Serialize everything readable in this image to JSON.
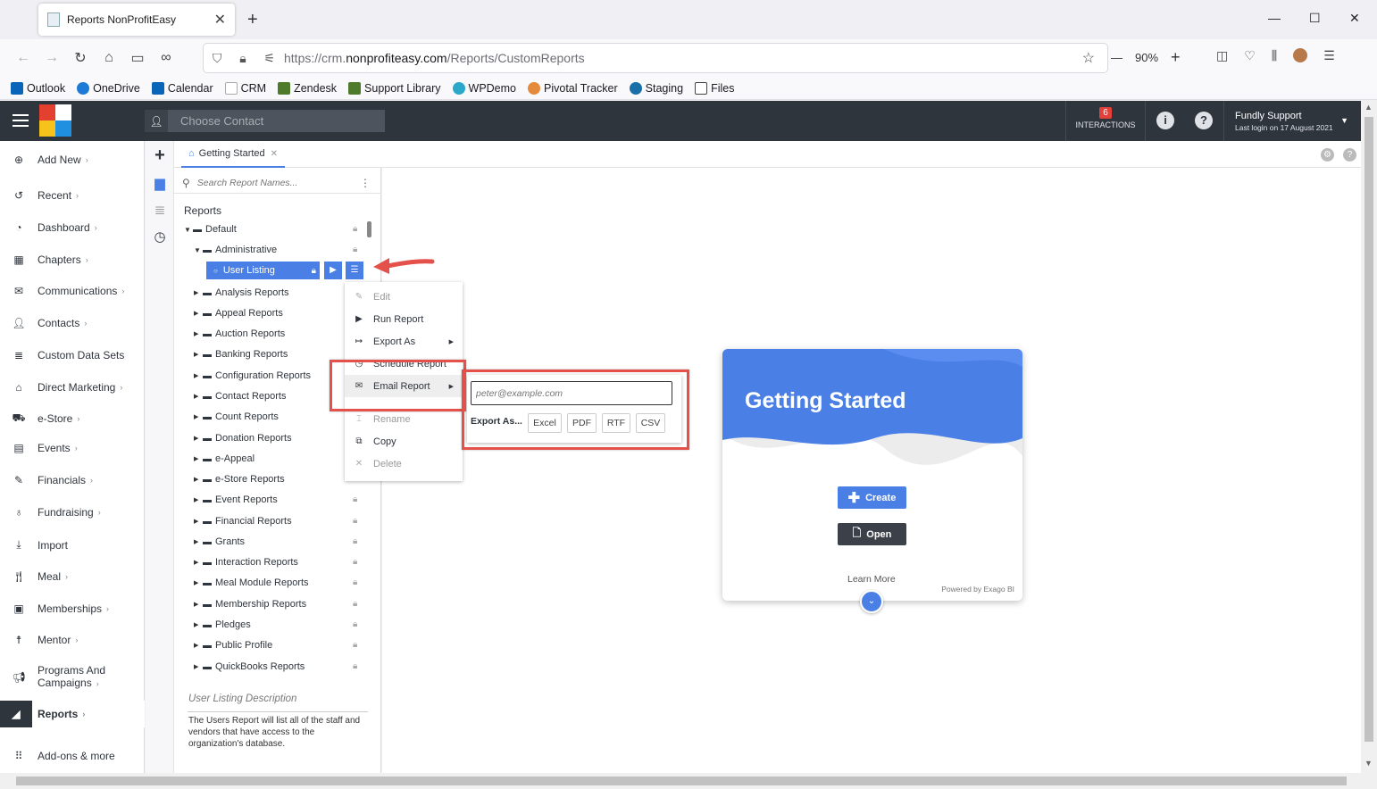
{
  "browser": {
    "tab_title": "Reports NonProfitEasy",
    "url_prefix": "https://crm.",
    "url_domain": "nonprofiteasy.com",
    "url_path": "/Reports/CustomReports",
    "zoom": "90%",
    "bookmarks": [
      "Outlook",
      "OneDrive",
      "Calendar",
      "CRM",
      "Zendesk",
      "Support Library",
      "WPDemo",
      "Pivotal Tracker",
      "Staging",
      "Files"
    ]
  },
  "header": {
    "contact_placeholder": "Choose Contact",
    "interactions_count": "6",
    "interactions_label": "INTERACTIONS",
    "user_name": "Fundly Support",
    "last_login": "Last login on 17 August 2021"
  },
  "sidebar": {
    "items": [
      {
        "label": "Add New",
        "icon": "plus-circle-icon"
      },
      {
        "label": "Recent",
        "icon": "history-icon"
      },
      {
        "label": "Dashboard",
        "icon": "dashboard-icon"
      },
      {
        "label": "Chapters",
        "icon": "grid-icon"
      },
      {
        "label": "Communications",
        "icon": "envelope-icon"
      },
      {
        "label": "Contacts",
        "icon": "user-icon"
      },
      {
        "label": "Custom Data Sets",
        "icon": "database-icon"
      },
      {
        "label": "Direct Marketing",
        "icon": "building-icon"
      },
      {
        "label": "e-Store",
        "icon": "cart-icon"
      },
      {
        "label": "Events",
        "icon": "calendar-icon"
      },
      {
        "label": "Financials",
        "icon": "money-icon"
      },
      {
        "label": "Fundraising",
        "icon": "fundraising-icon"
      },
      {
        "label": "Import",
        "icon": "import-icon"
      },
      {
        "label": "Meal",
        "icon": "utensils-icon"
      },
      {
        "label": "Memberships",
        "icon": "id-card-icon"
      },
      {
        "label": "Mentor",
        "icon": "mentor-icon"
      },
      {
        "label": "Programs And",
        "label2": "Campaigns",
        "icon": "megaphone-icon"
      },
      {
        "label": "Reports",
        "icon": "chart-icon"
      },
      {
        "label": "Add-ons & more",
        "icon": "apps-icon"
      }
    ]
  },
  "tabs": {
    "getting_started": "Getting Started"
  },
  "tree": {
    "search_placeholder": "Search Report Names...",
    "heading": "Reports",
    "default_label": "Default",
    "administrative_label": "Administrative",
    "selected_label": "User Listing",
    "folders": [
      "Analysis Reports",
      "Appeal Reports",
      "Auction Reports",
      "Banking Reports",
      "Configuration Reports",
      "Contact Reports",
      "Count Reports",
      "Donation Reports",
      "e-Appeal",
      "e-Store Reports",
      "Event Reports",
      "Financial Reports",
      "Grants",
      "Interaction Reports",
      "Meal Module Reports",
      "Membership Reports",
      "Pledges",
      "Public Profile",
      "QuickBooks Reports"
    ],
    "description_title": "User Listing Description",
    "description_text": "The Users Report will list all of the staff and vendors that have access to the organization's database."
  },
  "context_menu": {
    "items": [
      {
        "label": "Edit",
        "disabled": true
      },
      {
        "label": "Run Report",
        "disabled": false
      },
      {
        "label": "Export As",
        "disabled": false
      },
      {
        "label": "Schedule Report",
        "disabled": false
      },
      {
        "label": "Email Report",
        "disabled": false
      },
      {
        "label": "Rename",
        "disabled": true
      },
      {
        "label": "Copy",
        "disabled": false
      },
      {
        "label": "Delete",
        "disabled": true
      }
    ]
  },
  "email_submenu": {
    "placeholder": "peter@example.com",
    "export_label": "Export As...",
    "formats": [
      "Excel",
      "PDF",
      "RTF",
      "CSV"
    ]
  },
  "card": {
    "title": "Getting Started",
    "create_label": "Create",
    "open_label": "Open",
    "learn_more": "Learn More",
    "powered_by": "Powered by Exago BI"
  },
  "colors": {
    "accent": "#4a7fe6",
    "header_bg": "#2f353d",
    "annotation_red": "#e4514a"
  }
}
